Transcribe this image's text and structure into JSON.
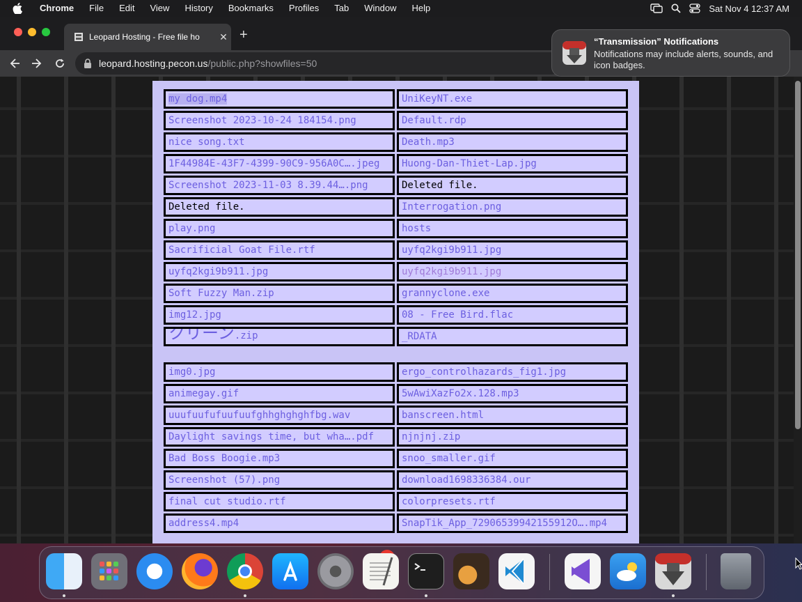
{
  "menubar": {
    "app": "Chrome",
    "items": [
      "File",
      "Edit",
      "View",
      "History",
      "Bookmarks",
      "Profiles",
      "Tab",
      "Window",
      "Help"
    ],
    "clock": "Sat Nov 4  12:37 AM"
  },
  "browser": {
    "tab_title": "Leopard Hosting - Free file ho",
    "url_host": "leopard.hosting.pecon.us",
    "url_path": "/public.php?showfiles=50"
  },
  "notification": {
    "title": "“Transmission” Notifications",
    "body": "Notifications may include alerts, sounds, and icon badges."
  },
  "files": [
    {
      "left": "my dog.mp4",
      "right": "UniKeyNT.exe"
    },
    {
      "left": "Screenshot 2023-10-24 184154.png",
      "right": "Default.rdp"
    },
    {
      "left": "nice song.txt",
      "right": "Death.mp3"
    },
    {
      "left": "1F44984E-43F7-4399-90C9-956A0C….jpeg",
      "right": "Huong-Dan-Thiet-Lap.jpg"
    },
    {
      "left": "Screenshot 2023-11-03 8.39.44….png",
      "right": "Deleted file."
    },
    {
      "left": "Deleted file.",
      "right": "Interrogation.png"
    },
    {
      "left": "play.png",
      "right": "hosts"
    },
    {
      "left": "Sacrificial Goat File.rtf",
      "right": "uyfq2kgi9b911.jpg"
    },
    {
      "left": "uyfq2kgi9b911.jpg",
      "right": "uyfq2kgi9b911.jpg"
    },
    {
      "left": "Soft Fuzzy Man.zip",
      "right": "grannyclone.exe"
    },
    {
      "left": "img12.jpg",
      "right": "08 - Free Bird.flac"
    },
    {
      "left_big": "ブルースクリーン&レッドス",
      "left_big2": "クリーン",
      "left_small": ".zip",
      "right": "_RDATA"
    },
    {
      "left": "img0.jpg",
      "right": "ergo_controlhazards_fig1.jpg"
    },
    {
      "left": "animegay.gif",
      "right": "5wAwiXazFo2x.128.mp3"
    },
    {
      "left": "uuufuufufuufuufghhghghghfbg.wav",
      "right": "banscreen.html"
    },
    {
      "left": "Daylight savings time, but wha….pdf",
      "right": "njnjnj.zip"
    },
    {
      "left": "Bad Boss Boogie.mp3",
      "right": "snoo_smaller.gif"
    },
    {
      "left": "Screenshot (57).png",
      "right": "download1698336384.our"
    },
    {
      "left": "final cut studio.rtf",
      "right": "colorpresets.rtf"
    },
    {
      "left": "address4.mp4",
      "right": "SnapTik_App_72906539942155912O….mp4"
    }
  ],
  "dock": {
    "badge_count": "1",
    "apps": [
      "finder-icon",
      "launchpad-icon",
      "safari-icon",
      "firefox-icon",
      "chrome-icon",
      "app-store-icon",
      "system-settings-icon",
      "textedit-icon",
      "terminal-icon",
      "garageband-icon",
      "vscode-icon",
      "visual-studio-icon",
      "weather-icon",
      "transmission-icon",
      "trash-icon"
    ]
  },
  "colors": {
    "panel": "#c9c4f6",
    "cell": "#d2ccff",
    "link": "#6c5fe0",
    "deleted_text": "#000000"
  }
}
